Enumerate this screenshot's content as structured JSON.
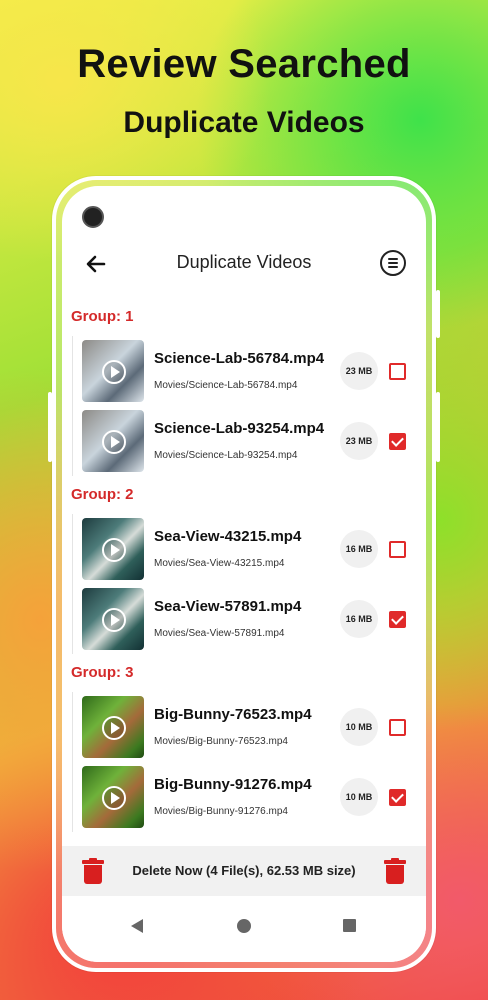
{
  "hero": {
    "line1": "Review Searched",
    "line2": "Duplicate Videos"
  },
  "appbar": {
    "title": "Duplicate Videos",
    "back_icon": "arrow-left-icon",
    "menu_icon": "list-menu-icon"
  },
  "groups": [
    {
      "label": "Group: 1",
      "items": [
        {
          "name": "Science-Lab-56784.mp4",
          "path": "Movies/Science-Lab-56784.mp4",
          "size": "23 MB",
          "checked": false
        },
        {
          "name": "Science-Lab-93254.mp4",
          "path": "Movies/Science-Lab-93254.mp4",
          "size": "23 MB",
          "checked": true
        }
      ]
    },
    {
      "label": "Group: 2",
      "items": [
        {
          "name": "Sea-View-43215.mp4",
          "path": "Movies/Sea-View-43215.mp4",
          "size": "16 MB",
          "checked": false
        },
        {
          "name": "Sea-View-57891.mp4",
          "path": "Movies/Sea-View-57891.mp4",
          "size": "16 MB",
          "checked": true
        }
      ]
    },
    {
      "label": "Group: 3",
      "items": [
        {
          "name": "Big-Bunny-76523.mp4",
          "path": "Movies/Big-Bunny-76523.mp4",
          "size": "10 MB",
          "checked": false
        },
        {
          "name": "Big-Bunny-91276.mp4",
          "path": "Movies/Big-Bunny-91276.mp4",
          "size": "10 MB",
          "checked": true
        }
      ]
    }
  ],
  "bottom_bar": {
    "delete_label": "Delete Now (4 File(s), 62.53 MB size)",
    "trash_icon": "trash-icon"
  },
  "colors": {
    "accent": "#e02a2a",
    "group_label": "#d42a2a"
  }
}
